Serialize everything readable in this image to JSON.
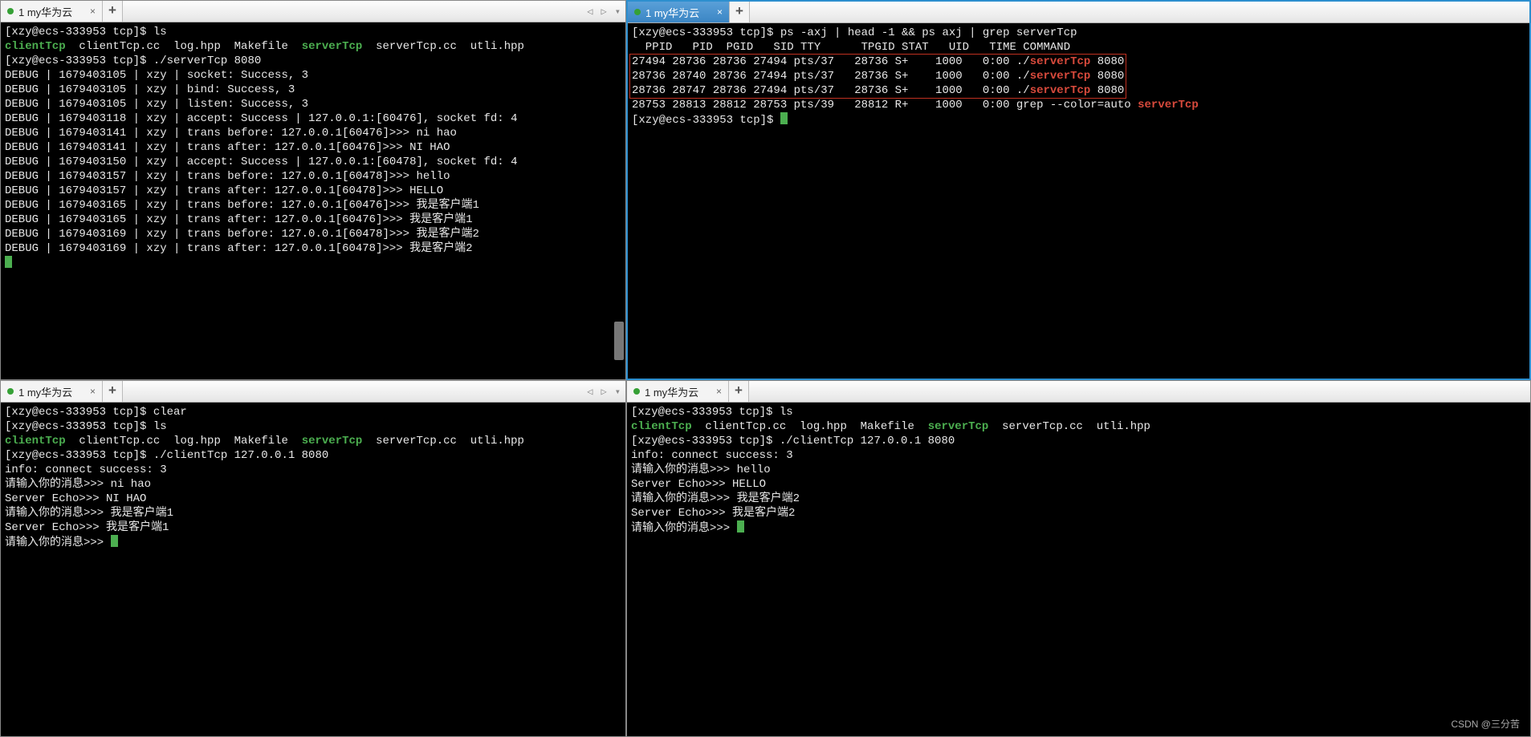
{
  "tabs": {
    "tl": {
      "label": "1 my华为云"
    },
    "tr": {
      "label": "1 my华为云"
    },
    "bl": {
      "label": "1 my华为云"
    },
    "br": {
      "label": "1 my华为云"
    }
  },
  "tl": {
    "prompt1": "[xzy@ecs-333953 tcp]$ ls",
    "files_1": "clientTcp",
    "files_2": "  clientTcp.cc  log.hpp  Makefile  ",
    "files_3": "serverTcp",
    "files_4": "  serverTcp.cc  utli.hpp",
    "prompt2": "[xzy@ecs-333953 tcp]$ ./serverTcp 8080",
    "lines": [
      "DEBUG | 1679403105 | xzy | socket: Success, 3",
      "DEBUG | 1679403105 | xzy | bind: Success, 3",
      "DEBUG | 1679403105 | xzy | listen: Success, 3",
      "DEBUG | 1679403118 | xzy | accept: Success | 127.0.0.1:[60476], socket fd: 4",
      "DEBUG | 1679403141 | xzy | trans before: 127.0.0.1[60476]>>> ni hao",
      "DEBUG | 1679403141 | xzy | trans after: 127.0.0.1[60476]>>> NI HAO",
      "DEBUG | 1679403150 | xzy | accept: Success | 127.0.0.1:[60478], socket fd: 4",
      "DEBUG | 1679403157 | xzy | trans before: 127.0.0.1[60478]>>> hello",
      "DEBUG | 1679403157 | xzy | trans after: 127.0.0.1[60478]>>> HELLO",
      "DEBUG | 1679403165 | xzy | trans before: 127.0.0.1[60476]>>> 我是客户端1",
      "DEBUG | 1679403165 | xzy | trans after: 127.0.0.1[60476]>>> 我是客户端1",
      "DEBUG | 1679403169 | xzy | trans before: 127.0.0.1[60478]>>> 我是客户端2",
      "DEBUG | 1679403169 | xzy | trans after: 127.0.0.1[60478]>>> 我是客户端2"
    ]
  },
  "tr": {
    "prompt1": "[xzy@ecs-333953 tcp]$ ps -axj | head -1 && ps axj | grep serverTcp",
    "header": "  PPID   PID  PGID   SID TTY      TPGID STAT   UID   TIME COMMAND",
    "rows": [
      {
        "a": "27494 28736 28736 27494 pts/37   28736 S+    1000   0:00 ./",
        "b": "serverTcp",
        "c": " 8080"
      },
      {
        "a": "28736 28740 28736 27494 pts/37   28736 S+    1000   0:00 ./",
        "b": "serverTcp",
        "c": " 8080"
      },
      {
        "a": "28736 28747 28736 27494 pts/37   28736 S+    1000   0:00 ./",
        "b": "serverTcp",
        "c": " 8080"
      }
    ],
    "row4a": "28753 28813 28812 28753 pts/39   28812 R+    1000   0:00 grep --color=auto ",
    "row4b": "serverTcp",
    "prompt2": "[xzy@ecs-333953 tcp]$ "
  },
  "bl": {
    "l1": "[xzy@ecs-333953 tcp]$ clear",
    "l2": "[xzy@ecs-333953 tcp]$ ls",
    "files_1": "clientTcp",
    "files_2": "  clientTcp.cc  log.hpp  Makefile  ",
    "files_3": "serverTcp",
    "files_4": "  serverTcp.cc  utli.hpp",
    "l3": "[xzy@ecs-333953 tcp]$ ./clientTcp 127.0.0.1 8080",
    "l4": "info: connect success: 3",
    "l5": "请输入你的消息>>> ni hao",
    "l6": "Server Echo>>> NI HAO",
    "l7": "请输入你的消息>>> 我是客户端1",
    "l8": "Server Echo>>> 我是客户端1",
    "l9": "请输入你的消息>>> "
  },
  "br": {
    "l1": "[xzy@ecs-333953 tcp]$ ls",
    "files_1": "clientTcp",
    "files_2": "  clientTcp.cc  log.hpp  Makefile  ",
    "files_3": "serverTcp",
    "files_4": "  serverTcp.cc  utli.hpp",
    "l2": "[xzy@ecs-333953 tcp]$ ./clientTcp 127.0.0.1 8080",
    "l3": "info: connect success: 3",
    "l4": "请输入你的消息>>> hello",
    "l5": "Server Echo>>> HELLO",
    "l6": "请输入你的消息>>> 我是客户端2",
    "l7": "Server Echo>>> 我是客户端2",
    "l8": "请输入你的消息>>> "
  },
  "watermark": "CSDN @三分苦"
}
